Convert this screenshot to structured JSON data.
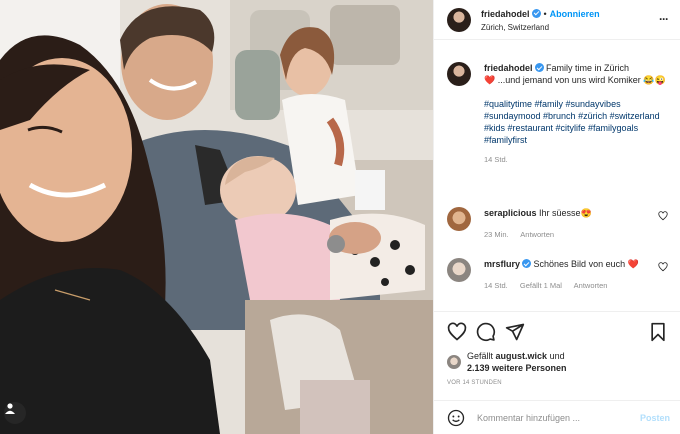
{
  "header": {
    "username": "friedahodel",
    "separator": "•",
    "follow_label": "Abonnieren",
    "location": "Zürich, Switzerland",
    "more_icon": "more-horizontal-icon"
  },
  "caption": {
    "username": "friedahodel",
    "text": "Family time in Zürich",
    "text_2": "...und jemand von uns wird Komiker",
    "emojis_1": "❤️",
    "emojis_2": "😂😜",
    "hashtags": "#qualitytime #family #sundayvibes #sundaymood #brunch #zürich #switzerland #kids #restaurant #citylife #familygoals #familyfirst",
    "time": "14 Std."
  },
  "comments": [
    {
      "username": "seraplicious",
      "text": "Ihr süesse",
      "emoji": "😍",
      "time": "23 Min.",
      "reply_label": "Antworten"
    },
    {
      "username": "mrsflury",
      "text": "Schönes Bild von euch",
      "emoji": "❤️",
      "time": "14 Std.",
      "likes_label": "Gefällt 1 Mal",
      "reply_label": "Antworten"
    }
  ],
  "likes": {
    "prefix": "Gefällt",
    "user": "august.wick",
    "conj": "und",
    "count_text": "2.139 weitere Personen"
  },
  "timestamp": "VOR 14 STUNDEN",
  "add_comment": {
    "placeholder": "Kommentar hinzufügen ...",
    "post_label": "Posten"
  },
  "colors": {
    "accent": "#0095f6",
    "verified": "#3897f0",
    "like_red": "#ed4956",
    "hashtag": "#00376b",
    "muted": "#8e8e8e"
  }
}
